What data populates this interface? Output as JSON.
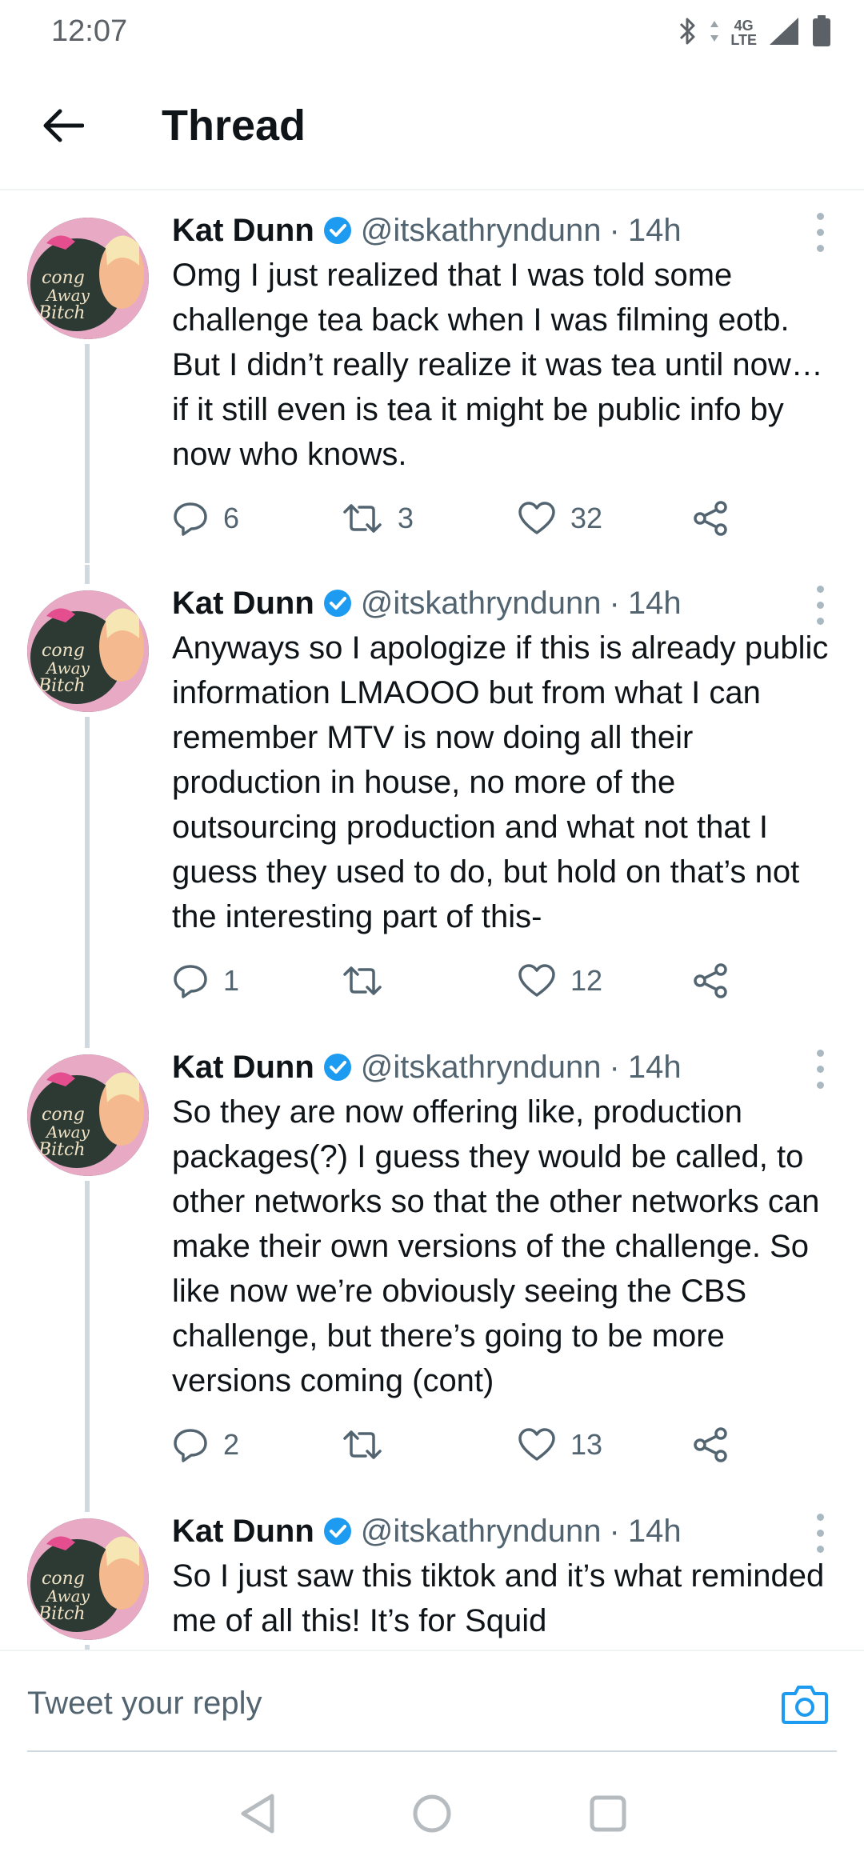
{
  "status_bar": {
    "time": "12:07",
    "network_top": "4G",
    "network_bottom": "LTE",
    "icons": [
      "bluetooth-icon",
      "signal-icon",
      "battery-icon"
    ]
  },
  "header": {
    "title": "Thread",
    "back_icon": "arrow-left-icon"
  },
  "tweets": [
    {
      "name": "Kat Dunn",
      "handle": "@itskathryndunn",
      "separator": "·",
      "time": "14h",
      "text": "Omg I just realized that I was told some challenge tea back when I was filming eotb. But I didn’t really realize it was tea until now… if it still even is tea it might be public info by now who knows.",
      "replies": "6",
      "retweets": "3",
      "likes": "32"
    },
    {
      "name": "Kat Dunn",
      "handle": "@itskathryndunn",
      "separator": "·",
      "time": "14h",
      "text": "Anyways so I apologize if this is already public information LMAOOO but from what I can remember MTV is now doing all their production in house, no more of the outsourcing production and what not that I guess they used to do, but hold on that’s not the interesting part of this-",
      "replies": "1",
      "retweets": "",
      "likes": "12"
    },
    {
      "name": "Kat Dunn",
      "handle": "@itskathryndunn",
      "separator": "·",
      "time": "14h",
      "text": "So they are now offering like, production packages(?) I guess they would be called, to other networks so that the other networks can make their own versions of the challenge. So like now we’re obviously seeing the CBS challenge, but there’s going to be more versions coming (cont)",
      "replies": "2",
      "retweets": "",
      "likes": "13"
    },
    {
      "name": "Kat Dunn",
      "handle": "@itskathryndunn",
      "separator": "·",
      "time": "14h",
      "text": "So I just saw this tiktok and it’s what reminded me of all this! It’s for Squid"
    }
  ],
  "composer": {
    "placeholder": "Tweet your reply",
    "camera_icon": "camera-icon"
  },
  "nav": {
    "icons": [
      "back-triangle-icon",
      "home-circle-icon",
      "recents-square-icon"
    ]
  },
  "colors": {
    "accent": "#1d9bf0",
    "text_primary": "#0f1419",
    "text_secondary": "#536471",
    "thread_line": "#cfd9de"
  }
}
